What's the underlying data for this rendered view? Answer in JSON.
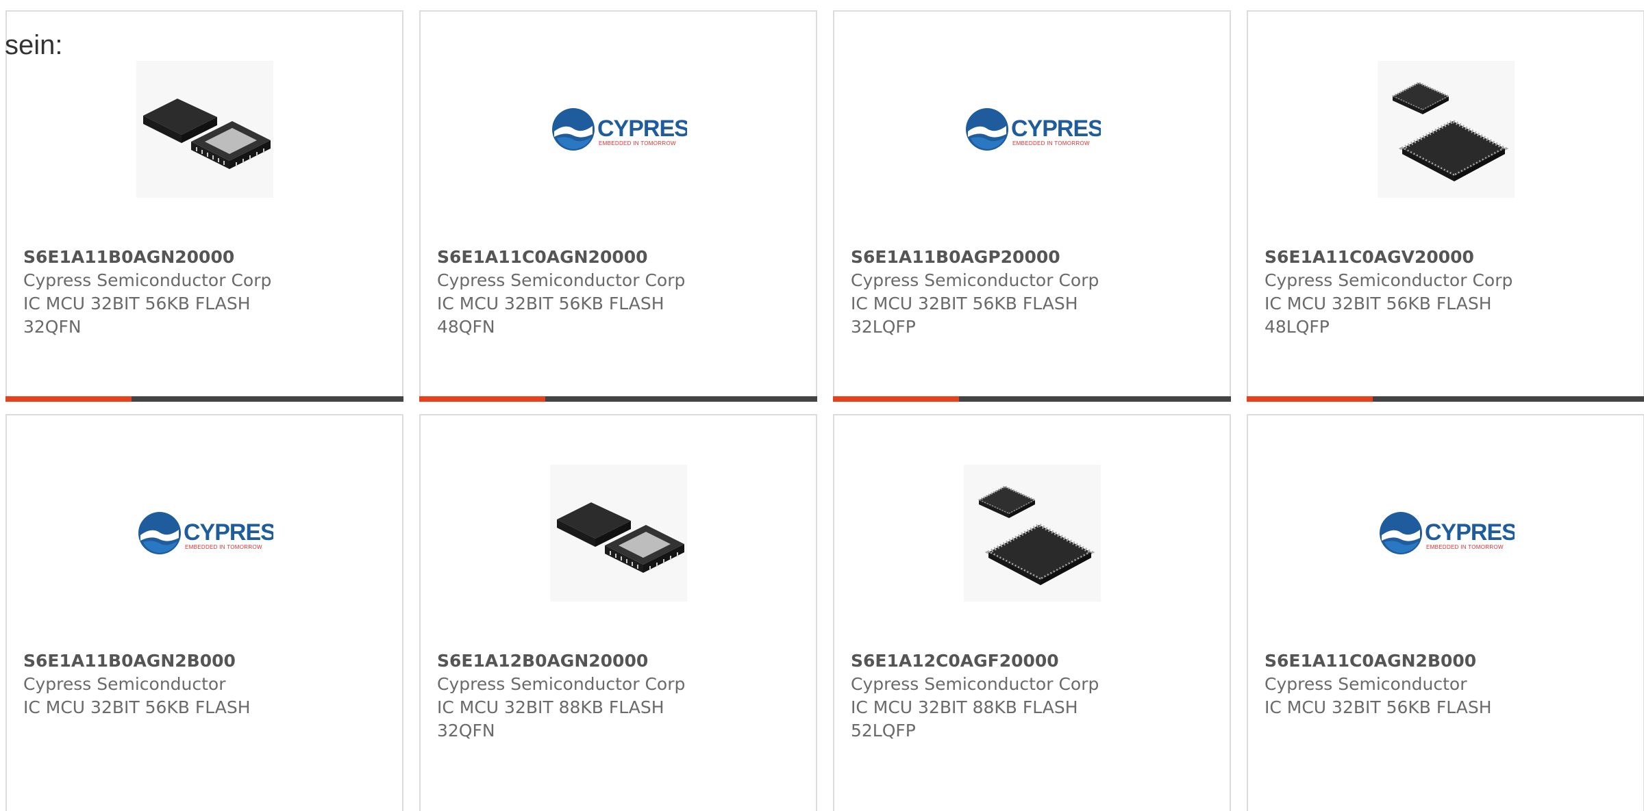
{
  "intro_text": "sein:",
  "colors": {
    "accent": "#e8401c",
    "bar": "#444444",
    "border": "#dcdcdc",
    "text": "#666666"
  },
  "products": [
    {
      "part": "S6E1A11B0AGN20000",
      "manufacturer": "Cypress Semiconductor Corp",
      "desc1": "IC MCU 32BIT 56KB FLASH",
      "desc2": "32QFN",
      "image": "qfn-chip-icon"
    },
    {
      "part": "S6E1A11C0AGN20000",
      "manufacturer": "Cypress Semiconductor Corp",
      "desc1": "IC MCU 32BIT 56KB FLASH",
      "desc2": "48QFN",
      "image": "cypress-logo"
    },
    {
      "part": "S6E1A11B0AGP20000",
      "manufacturer": "Cypress Semiconductor Corp",
      "desc1": "IC MCU 32BIT 56KB FLASH",
      "desc2": "32LQFP",
      "image": "cypress-logo"
    },
    {
      "part": "S6E1A11C0AGV20000",
      "manufacturer": "Cypress Semiconductor Corp",
      "desc1": "IC MCU 32BIT 56KB FLASH",
      "desc2": "48LQFP",
      "image": "lqfp-chip-icon"
    },
    {
      "part": "S6E1A11B0AGN2B000",
      "manufacturer": "Cypress Semiconductor",
      "desc1": "IC MCU 32BIT 56KB FLASH",
      "desc2": "",
      "image": "cypress-logo"
    },
    {
      "part": "S6E1A12B0AGN20000",
      "manufacturer": "Cypress Semiconductor Corp",
      "desc1": "IC MCU 32BIT 88KB FLASH",
      "desc2": "32QFN",
      "image": "qfn-chip-icon"
    },
    {
      "part": "S6E1A12C0AGF20000",
      "manufacturer": "Cypress Semiconductor Corp",
      "desc1": "IC MCU 32BIT 88KB FLASH",
      "desc2": "52LQFP",
      "image": "lqfp-chip-icon"
    },
    {
      "part": "S6E1A11C0AGN2B000",
      "manufacturer": "Cypress Semiconductor",
      "desc1": "IC MCU 32BIT 56KB FLASH",
      "desc2": "",
      "image": "cypress-logo"
    }
  ],
  "logo": {
    "brand": "CYPRESS",
    "tagline": "EMBEDDED IN TOMORROW"
  }
}
